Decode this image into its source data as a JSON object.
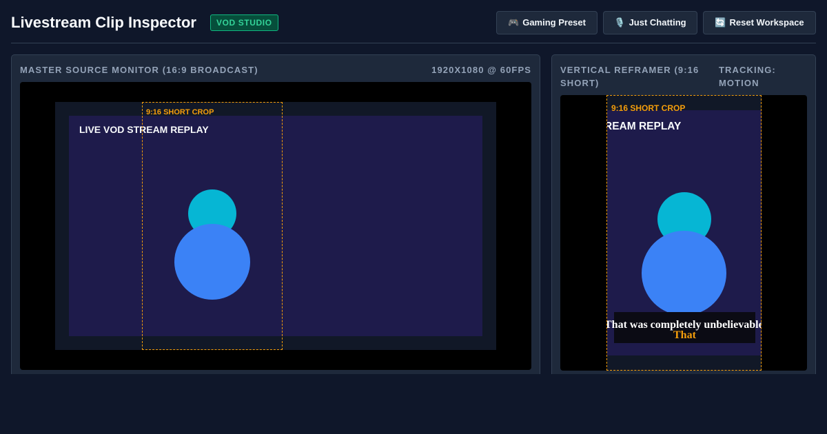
{
  "app": {
    "title": "Livestream Clip Inspector",
    "badge": "VOD STUDIO"
  },
  "toolbar": {
    "buttons": [
      {
        "icon": "🎮",
        "icon_name": "gamepad-icon",
        "label": "Gaming Preset"
      },
      {
        "icon": "🎙️",
        "icon_name": "microphone-icon",
        "label": "Just Chatting"
      },
      {
        "icon": "🔄",
        "icon_name": "refresh-icon",
        "label": "Reset Workspace"
      }
    ]
  },
  "master_monitor": {
    "title": "MASTER SOURCE MONITOR (16:9 BROADCAST)",
    "spec": "1920X1080 @ 60FPS",
    "stage_text": "LIVE VOD STREAM REPLAY",
    "crop_label": "9:16 SHORT CROP"
  },
  "vertical_reframer": {
    "title_line1": "VERTICAL REFRAMER (9:16",
    "title_line2": "SHORT)",
    "tracking_line1": "TRACKING:",
    "tracking_line2": "MOTION",
    "stage_text": "REAM REPLAY",
    "crop_label": "9:16 SHORT CROP",
    "caption_line": "That was completely unbelievable",
    "caption_highlight": "That"
  },
  "colors": {
    "background": "#0f172a",
    "panel": "#1e293b",
    "accent_crop": "#f59e0b",
    "badge": "#34d399",
    "stage": "#1e1b4b",
    "head": "#06b6d4",
    "body": "#3b82f6"
  }
}
